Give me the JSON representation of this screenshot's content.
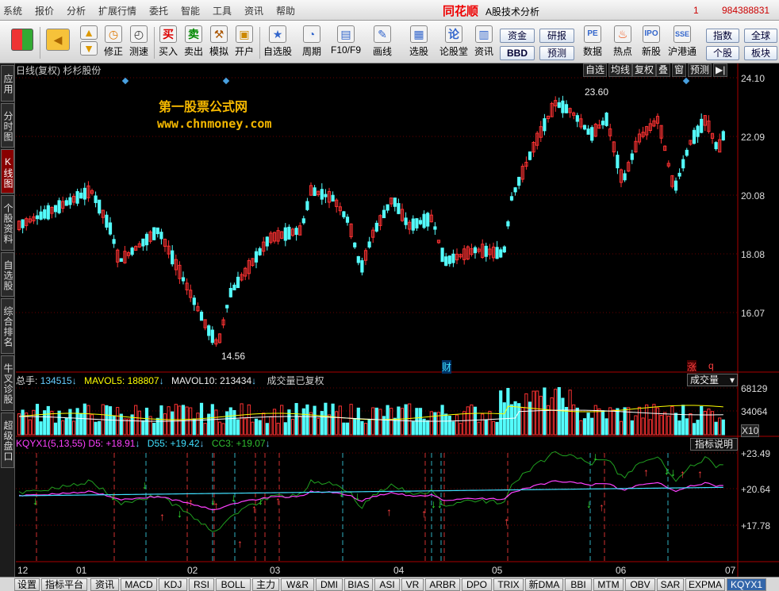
{
  "menu": {
    "items": [
      "系统",
      "报价",
      "分析",
      "扩展行情",
      "委托",
      "智能",
      "工具",
      "资讯",
      "帮助"
    ],
    "brand": "同花顺",
    "app": "A股技术分析",
    "num1": "1",
    "num2": "984388831"
  },
  "toolbar": {
    "buttons": [
      "修正",
      "测速",
      "买入",
      "卖出",
      "模拟",
      "开户",
      "自选股",
      "周期",
      "F10/F9",
      "画线",
      "选股",
      "论股堂",
      "资讯",
      "数据",
      "热点",
      "新股",
      "沪港通"
    ],
    "icons": [
      "买",
      "卖",
      "论"
    ],
    "small": [
      "资金",
      "BBD",
      "研报",
      "预测",
      "指数",
      "个股",
      "全球",
      "板块"
    ]
  },
  "sidetabs": [
    "应用",
    "分时图",
    "K线图",
    "个股资料",
    "自选股",
    "综合排名",
    "牛叉诊股",
    "超级盘口"
  ],
  "chart": {
    "title": "日线(复权) 杉杉股份",
    "right": [
      "自选",
      "均线",
      "复权",
      "叠",
      "窗",
      "预测"
    ],
    "wm1": "第一股票公式网",
    "wm2": "www.chnmoney.com",
    "high": "23.60",
    "low": "14.56",
    "cai": "财",
    "zhang": "涨",
    "q": "q"
  },
  "price_axis": [
    "24.10",
    "22.09",
    "20.08",
    "18.08",
    "16.07"
  ],
  "volume": {
    "zongshou_label": "总手:",
    "zongshou": "134515",
    "mavol5_label": "MAVOL5:",
    "mavol5": "188807",
    "mavol10_label": "MAVOL10:",
    "mavol10": "213434",
    "note": "成交量已复权",
    "select": "成交量",
    "axis": [
      "68129",
      "34064",
      "X10"
    ]
  },
  "indicator": {
    "name": "KQYX1(5,13,55)",
    "d5": "D5: +18.91",
    "d55": "D55: +19.42",
    "cc3": "CC3: +19.07",
    "help": "指标说明",
    "axis": [
      "+23.49",
      "+20.64",
      "+17.78"
    ]
  },
  "dates": [
    "12",
    "01",
    "02",
    "03",
    "04",
    "05",
    "06",
    "07"
  ],
  "bottomtabs": [
    "设置",
    "指标平台",
    "资讯",
    "MACD",
    "KDJ",
    "RSI",
    "BOLL",
    "主力",
    "W&R",
    "DMI",
    "BIAS",
    "ASI",
    "VR",
    "ARBR",
    "DPO",
    "TRIX",
    "新DMA",
    "BBI",
    "MTM",
    "OBV",
    "SAR",
    "EXPMA",
    "KQYX1"
  ],
  "colors": {
    "up": "#ff3232",
    "down": "#54fcfc",
    "ma1": "#ffffff",
    "ma2": "#ffff00",
    "d5": "#ff40ff",
    "d55": "#40e0ff",
    "cc3": "#20a020"
  }
}
